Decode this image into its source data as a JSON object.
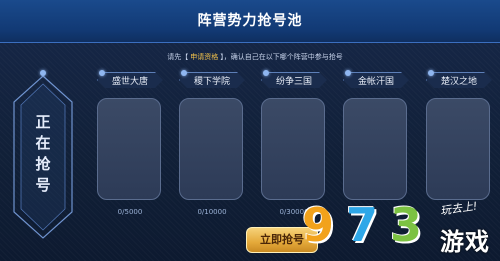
{
  "header": {
    "title": "阵营势力抢号池"
  },
  "notice": {
    "prefix": "请先",
    "apply_label": "申请资格",
    "suffix": "，确认自己在以下哪个阵营中参与抢号"
  },
  "status_banner": {
    "label": "正在抢号"
  },
  "factions": [
    {
      "name": "盛世大唐",
      "count": "0/5000"
    },
    {
      "name": "稷下学院",
      "count": "0/10000"
    },
    {
      "name": "纷争三国",
      "count": "0/30000"
    },
    {
      "name": "金帐汗国",
      "count": ""
    },
    {
      "name": "楚汉之地",
      "count": ""
    }
  ],
  "action": {
    "grab_label": "立即抢号"
  },
  "watermark": {
    "digits": [
      "9",
      "7",
      "3"
    ],
    "digit_colors": [
      "#f2a21b",
      "#2ea7e8",
      "#7cc242"
    ],
    "slogan": "玩去上!",
    "name": "游戏"
  }
}
